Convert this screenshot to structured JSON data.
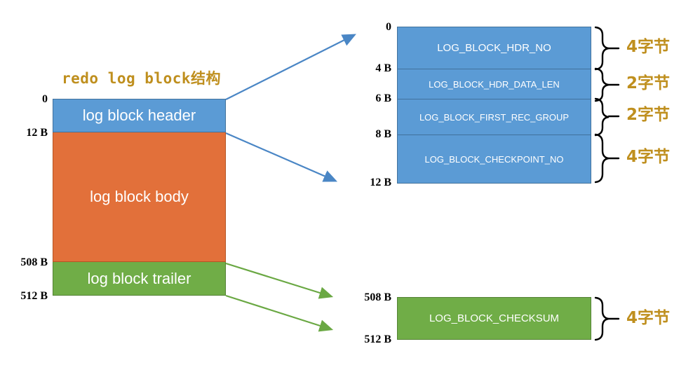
{
  "diagram": {
    "title": "redo log block结构",
    "title_color": "#bf8f1e",
    "colors": {
      "header_blue": "#5b9bd5",
      "body_orange": "#e2703a",
      "trailer_green": "#70ad47",
      "annotation_gold": "#bf8f1e",
      "offset_black": "#000000",
      "blue_arrow": "#4a86c5",
      "green_arrow": "#6aa843",
      "brace_black": "#000000"
    }
  },
  "main_block": {
    "offsets": [
      {
        "text": "0",
        "for": "log block header start"
      },
      {
        "text": "12 B",
        "for": "log block header end / body start"
      },
      {
        "text": "508 B",
        "for": "log block body end / trailer start"
      },
      {
        "text": "512 B",
        "for": "log block trailer end"
      }
    ],
    "sections": [
      {
        "label": "log block header",
        "color": "#5b9bd5"
      },
      {
        "label": "log block body",
        "color": "#e2703a"
      },
      {
        "label": "log block trailer",
        "color": "#70ad47"
      }
    ]
  },
  "header_detail": {
    "offsets": [
      {
        "text": "0"
      },
      {
        "text": "4 B"
      },
      {
        "text": "6 B"
      },
      {
        "text": "8 B"
      },
      {
        "text": "12 B"
      }
    ],
    "rows": [
      {
        "label": "LOG_BLOCK_HDR_NO",
        "size": "4字节",
        "emphasis": "large"
      },
      {
        "label": "LOG_BLOCK_HDR_DATA_LEN",
        "size": "2字节",
        "emphasis": "small"
      },
      {
        "label": "LOG_BLOCK_FIRST_REC_GROUP",
        "size": "2字节",
        "emphasis": "small"
      },
      {
        "label": "LOG_BLOCK_CHECKPOINT_NO",
        "size": "4字节",
        "emphasis": "small"
      }
    ]
  },
  "trailer_detail": {
    "offsets": [
      {
        "text": "508 B"
      },
      {
        "text": "512 B"
      }
    ],
    "rows": [
      {
        "label": "LOG_BLOCK_CHECKSUM",
        "size": "4字节",
        "emphasis": "large"
      }
    ]
  }
}
